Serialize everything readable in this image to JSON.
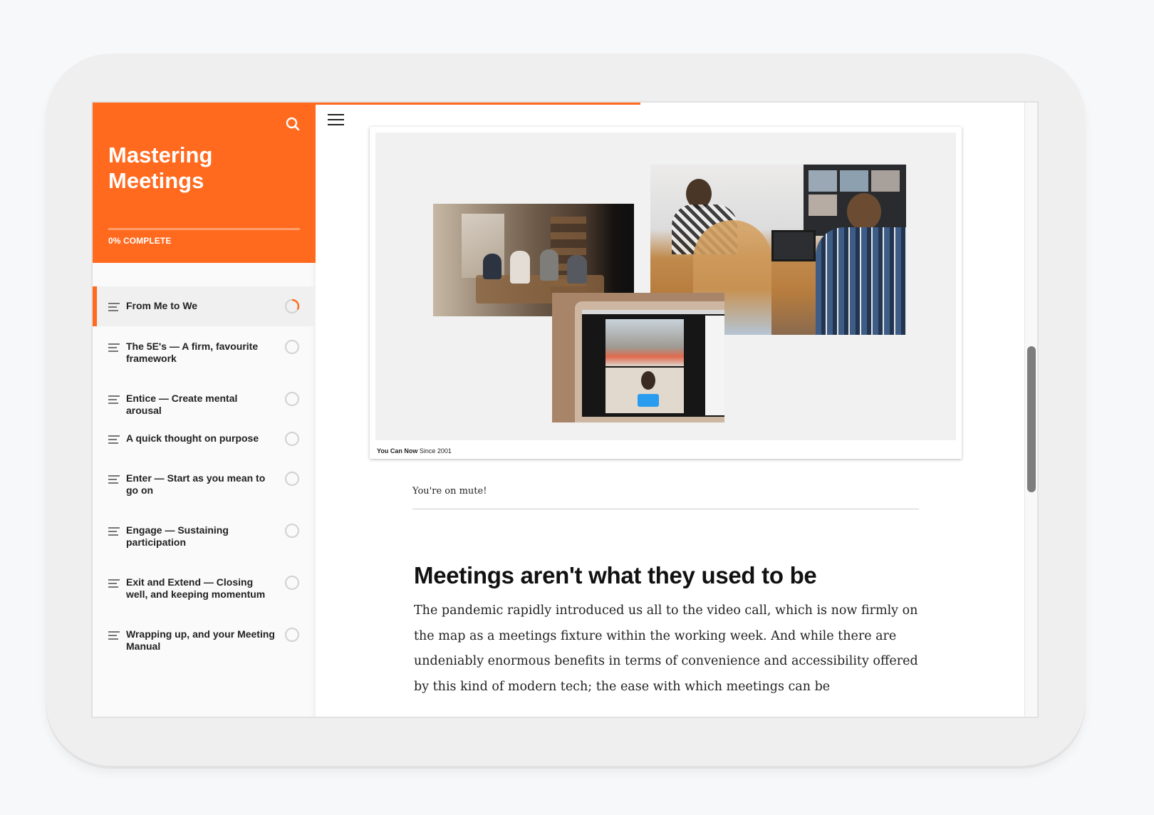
{
  "course": {
    "title": "Mastering Meetings",
    "progress_percent": 0,
    "progress_label": "0% COMPLETE",
    "accent_color": "#ff6a1f"
  },
  "header": {
    "search_icon": "search-icon",
    "menu_icon": "hamburger-menu-icon",
    "reading_progress_fraction": 0.45
  },
  "lessons": [
    {
      "label": "From Me to We",
      "status": "in-progress",
      "progress_fraction": 0.33,
      "active": true
    },
    {
      "label": "The 5E's — A firm, favourite framework",
      "status": "not-started",
      "progress_fraction": 0,
      "active": false
    },
    {
      "label": "Entice — Create mental arousal",
      "status": "not-started",
      "progress_fraction": 0,
      "active": false
    },
    {
      "label": "A quick thought on purpose",
      "status": "not-started",
      "progress_fraction": 0,
      "active": false
    },
    {
      "label": "Enter — Start as you mean to go on",
      "status": "not-started",
      "progress_fraction": 0,
      "active": false
    },
    {
      "label": "Engage — Sustaining participation",
      "status": "not-started",
      "progress_fraction": 0,
      "active": false
    },
    {
      "label": "Exit and Extend — Closing well, and keeping momentum",
      "status": "not-started",
      "progress_fraction": 0,
      "active": false
    },
    {
      "label": "Wrapping up, and your Meeting Manual",
      "status": "not-started",
      "progress_fraction": 0,
      "active": false
    }
  ],
  "media": {
    "caption_bold": "You Can Now",
    "caption_rest": " Since 2001",
    "subcaption": "You're on mute!",
    "photos": [
      "cafe-meeting-photo",
      "office-video-call-photo",
      "laptop-video-call-photo"
    ]
  },
  "article": {
    "title": "Meetings aren't what they used to be",
    "body": "The pandemic rapidly introduced us all to the video call, which is now firmly on the map as a meetings fixture within the working week. And while there are undeniably enormous benefits in terms of convenience and accessibility offered by this kind of modern tech; the ease with which meetings can be"
  },
  "scrollbar": {
    "position_fraction": 0.52
  }
}
